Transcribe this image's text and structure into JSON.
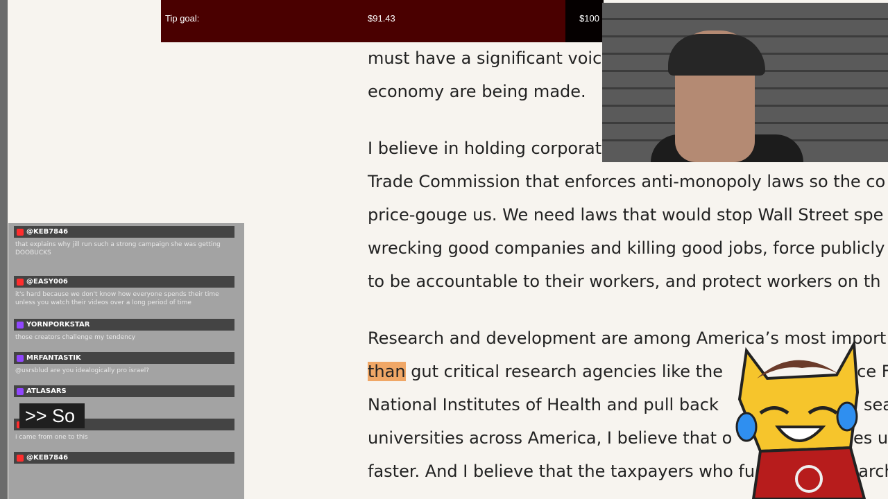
{
  "tip_goal": {
    "label": "Tip goal:",
    "current": "$91.43",
    "target": "$100",
    "progress_fraction": 0.9143
  },
  "article": {
    "lines": [
      "must have a significant voic",
      "economy are being made.",
      "I believe in holding corporat",
      "Trade Commission that enforces anti-monopoly laws so the co",
      "price-gouge us. We need laws that would stop Wall Street spe",
      "wrecking good companies and killing good jobs, force publicly",
      "to be accountable to their workers, and protect workers on th",
      "Research and development are among America’s most import",
      "gut critical research agencies like the",
      "nce Fo",
      "National Institutes of Health and pull back",
      "sea",
      "universities across America, I believe that o",
      "es u",
      "faster. And I believe that the taxpayers who fu",
      "search"
    ],
    "highlighted_word": "than"
  },
  "chat": {
    "messages": [
      {
        "user": "@KEB7846",
        "text": "that explains why jill run such a strong campaign she was getting DOOBUCKS",
        "badge_color": "#ff2d2d"
      },
      {
        "user": "@EASY006",
        "text": "it's hard because we don't know how everyone spends their time unless you watch their videos over a long period of time",
        "badge_color": "#ff2d2d"
      },
      {
        "user": "YORNPORKSTAR",
        "text": "those creators challenge my tendency",
        "badge_color": "#9146ff"
      },
      {
        "user": "MRFANTASTIK",
        "text": "@usrsblud are you idealogically pro israel?",
        "badge_color": "#9146ff"
      },
      {
        "user": "ATLASARS",
        "text": "",
        "badge_color": "#9146ff"
      },
      {
        "user": "",
        "text": "i came from one to this",
        "badge_color": "#ff2d2d"
      },
      {
        "user": "@KEB7846",
        "text": "",
        "badge_color": "#ff2d2d"
      }
    ]
  },
  "caption": {
    "text": ">> So"
  },
  "colors": {
    "tipbar_bg": "#4a0000",
    "highlight": "#f0a766",
    "chat_bg": "#a3a3a3",
    "page_bg": "#f7f4ef"
  }
}
